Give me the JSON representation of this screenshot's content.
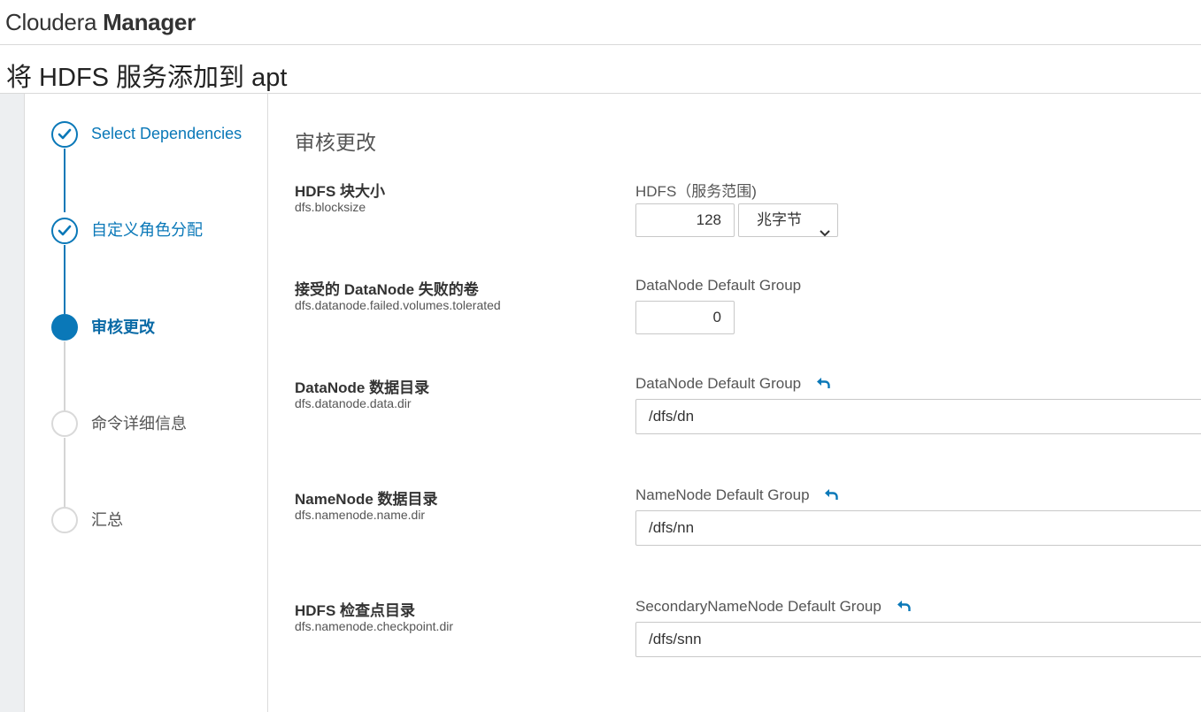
{
  "header": {
    "brand_light": "Cloudera",
    "brand_bold": "Manager"
  },
  "page": {
    "title": "将 HDFS 服务添加到 apt"
  },
  "wizard": {
    "steps": [
      {
        "label": "Select Dependencies",
        "state": "done"
      },
      {
        "label": "自定义角色分配",
        "state": "done"
      },
      {
        "label": "审核更改",
        "state": "current"
      },
      {
        "label": "命令详细信息",
        "state": "todo"
      },
      {
        "label": "汇总",
        "state": "todo"
      }
    ]
  },
  "main": {
    "section_title": "审核更改",
    "properties": [
      {
        "name": "HDFS 块大小",
        "key": "dfs.blocksize",
        "group": "HDFS（服务范围)",
        "value": "128",
        "unit": "兆字节"
      },
      {
        "name": "接受的 DataNode 失败的卷",
        "key": "dfs.datanode.failed.volumes.tolerated",
        "group": "DataNode Default Group",
        "value": "0"
      },
      {
        "name": "DataNode 数据目录",
        "key": "dfs.datanode.data.dir",
        "group": "DataNode Default Group",
        "value": "/dfs/dn"
      },
      {
        "name": "NameNode 数据目录",
        "key": "dfs.namenode.name.dir",
        "group": "NameNode Default Group",
        "value": "/dfs/nn"
      },
      {
        "name": "HDFS 检查点目录",
        "key": "dfs.namenode.checkpoint.dir",
        "group": "SecondaryNameNode Default Group",
        "value": "/dfs/snn"
      }
    ]
  },
  "colors": {
    "accent": "#0a78b8",
    "border": "#c8c8c8"
  },
  "icons": {
    "step_done": "check-icon",
    "undo": "undo-arrow-icon",
    "select": "chevron-down-icon"
  }
}
